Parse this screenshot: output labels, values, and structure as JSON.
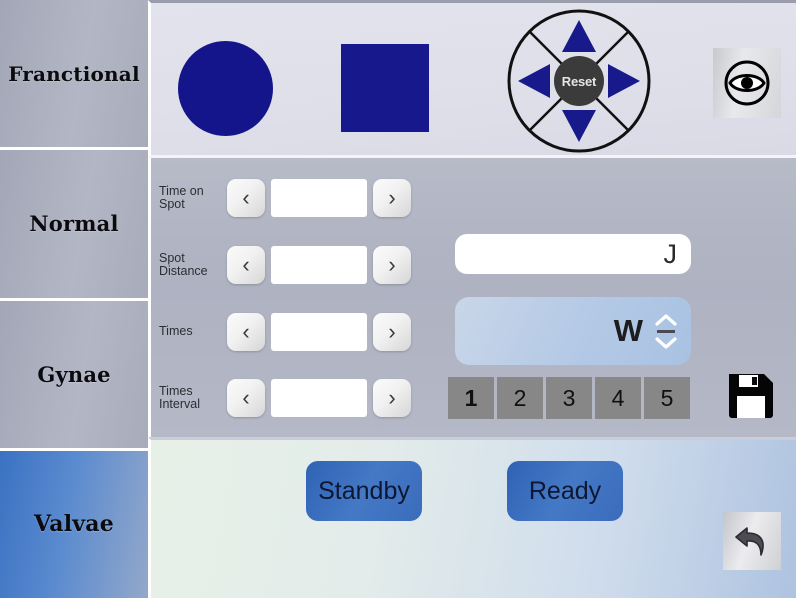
{
  "sidebar": {
    "items": [
      {
        "label": "Franctional",
        "active": false
      },
      {
        "label": "Normal",
        "active": false
      },
      {
        "label": "Gynae",
        "active": false
      },
      {
        "label": "Valvae",
        "active": true
      }
    ]
  },
  "toolbar": {
    "shape_circle_name": "circle-shape",
    "shape_square_name": "square-shape",
    "dpad": {
      "reset_label": "Reset",
      "up_name": "arrow-up-icon",
      "down_name": "arrow-down-icon",
      "left_name": "arrow-left-icon",
      "right_name": "arrow-right-icon"
    },
    "eye_icon": "eye-icon"
  },
  "parameters": {
    "rows": [
      {
        "label": "Time on\nSpot",
        "value": "",
        "prev": "‹",
        "next": "›"
      },
      {
        "label": "Spot\nDistance",
        "value": "",
        "prev": "‹",
        "next": "›"
      },
      {
        "label": "Times",
        "value": "",
        "prev": "‹",
        "next": "›"
      },
      {
        "label": "Times\nInterval",
        "value": "",
        "prev": "‹",
        "next": "›"
      }
    ]
  },
  "energy": {
    "joule": {
      "value": "",
      "unit": "J"
    },
    "watt": {
      "value": "",
      "unit": "W",
      "up": "⌃",
      "down": "⌄"
    }
  },
  "presets": {
    "items": [
      {
        "label": "1",
        "selected": true
      },
      {
        "label": "2",
        "selected": false
      },
      {
        "label": "3",
        "selected": false
      },
      {
        "label": "4",
        "selected": false
      },
      {
        "label": "5",
        "selected": false
      }
    ]
  },
  "save": {
    "icon": "floppy-save-icon"
  },
  "actions": {
    "standby_label": "Standby",
    "ready_label": "Ready",
    "back_icon": "undo-arrow-icon"
  },
  "colors": {
    "shape_navy": "#15168b",
    "accent_blue": "#3a6cbb",
    "sidebar_active": "#3a72c2",
    "preset_gray": "#878787"
  }
}
